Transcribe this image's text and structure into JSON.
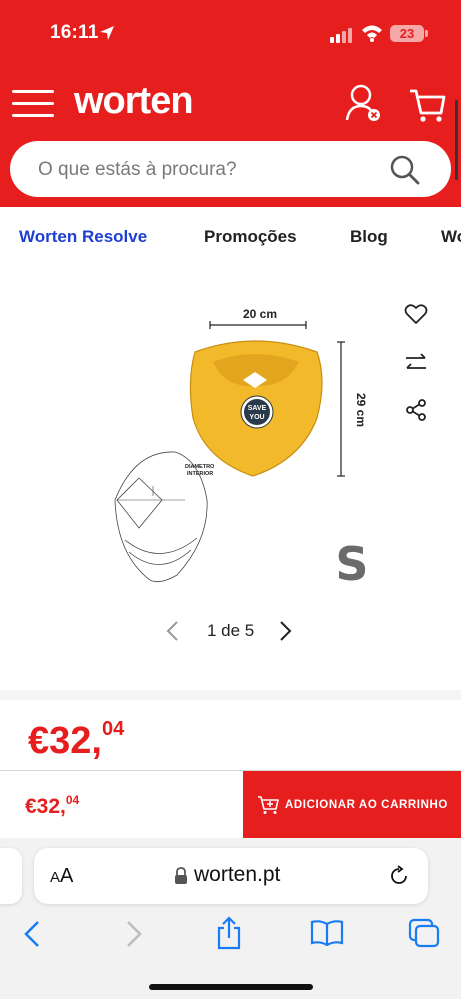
{
  "status_bar": {
    "time": "16:11",
    "battery": "23"
  },
  "header": {
    "brand": "worten",
    "menu_icon": "hamburger-icon",
    "account_icon": "user-icon",
    "cart_icon": "cart-icon"
  },
  "search": {
    "placeholder": "O que estás à procura?"
  },
  "nav": {
    "tabs": [
      {
        "label": "Worten Resolve",
        "active": true
      },
      {
        "label": "Promoções",
        "active": false
      },
      {
        "label": "Blog",
        "active": false
      },
      {
        "label": "Wo",
        "active": false
      }
    ]
  },
  "gallery": {
    "pager": "1 de 5",
    "image_labels": {
      "width": "20 cm",
      "height": "29 cm",
      "badge": "SAVE YOU",
      "diameter": "DIAMETRO INTERIOR",
      "size": "S"
    }
  },
  "price": {
    "integer": "€32,",
    "decimal": "04"
  },
  "sticky": {
    "price_integer": "€32,",
    "price_decimal": "04",
    "add_to_cart": "ADICIONAR AO CARRINHO"
  },
  "browser": {
    "aa_large": "A",
    "aa_small": "A",
    "url": "worten.pt"
  },
  "colors": {
    "brand_red": "#e61e1e",
    "active_tab_blue": "#1e3fd0",
    "product_yellow": "#f2b92b"
  }
}
